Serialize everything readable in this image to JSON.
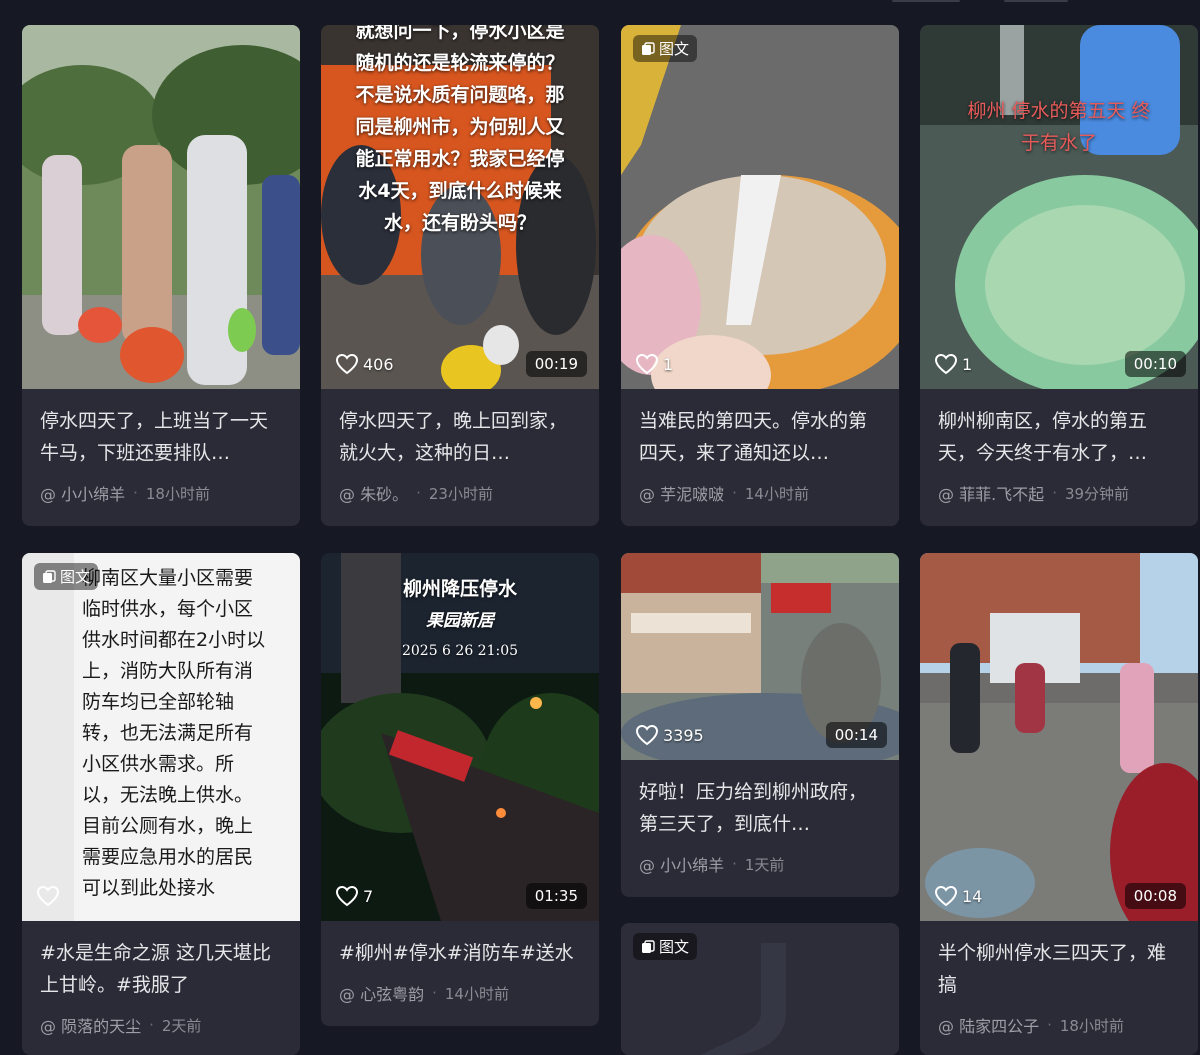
{
  "cards": [
    {
      "overlay_text": "",
      "likes": "",
      "duration": "",
      "badge": "",
      "description": "停水四天了，上班当了一天牛马，下班还要排队…",
      "author": "@ 小小绵羊",
      "time": "18小时前"
    },
    {
      "overlay_text": "就想问一下，停水小区是随机的还是轮流来停的？不是说水质有问题咯，那同是柳州市，为何别人又能正常用水？我家已经停水4天，到底什么时候来水，还有盼头吗？",
      "likes": "406",
      "duration": "00:19",
      "badge": "",
      "description": "停水四天了，晚上回到家，就火大，这种的日…",
      "author": "@ 朱砂。",
      "time": "23小时前"
    },
    {
      "overlay_text": "",
      "likes": "1",
      "duration": "",
      "badge": "图文",
      "description": "当难民的第四天。停水的第四天，来了通知还以…",
      "author": "@ 芋泥啵啵",
      "time": "14小时前"
    },
    {
      "overlay_text": "柳州 停水的第五天 终于有水了",
      "likes": "1",
      "duration": "00:10",
      "badge": "",
      "description": "柳州柳南区，停水的第五天，今天终于有水了，…",
      "author": "@ 菲菲.飞不起",
      "time": "39分钟前"
    },
    {
      "overlay_text": "柳南区大量小区需要临时供水，每个小区供水时间都在2小时以上，消防大队所有消防车均已全部轮轴转，也无法满足所有小区供水需求。所以，无法晚上供水。目前公厕有水，晚上需要应急用水的居民可以到此处接水",
      "likes": "",
      "duration": "",
      "badge": "图文",
      "description": "#水是生命之源 这几天堪比上甘岭。#我服了",
      "author": "@ 陨落的天尘",
      "time": "2天前"
    },
    {
      "overlay_text": "柳州降压停水",
      "overlay_sub": "果园新居",
      "overlay_date": "2025 6 26  21:05",
      "likes": "7",
      "duration": "01:35",
      "badge": "",
      "description": "#柳州#停水#消防车#送水",
      "author": "@ 心弦粤韵",
      "time": "14小时前"
    },
    {
      "overlay_text": "",
      "likes": "3395",
      "duration": "00:14",
      "badge": "",
      "description": "好啦！压力给到柳州政府，第三天了，到底什…",
      "author": "@ 小小绵羊",
      "time": "1天前"
    },
    {
      "overlay_text": "",
      "likes": "14",
      "duration": "00:08",
      "badge": "",
      "description": "半个柳州停水三四天了，难搞",
      "author": "@ 陆家四公子",
      "time": "18小时前"
    },
    {
      "overlay_text": "",
      "likes": "",
      "duration": "",
      "badge": "图文",
      "description": "",
      "author": "",
      "time": ""
    }
  ],
  "colors": {
    "page_bg": "#161823",
    "card_bg": "#2a2b36",
    "text_primary": "#e6e6e9",
    "text_secondary": "#8a8b93"
  },
  "icons": [
    "heart-icon",
    "image-text-icon"
  ]
}
